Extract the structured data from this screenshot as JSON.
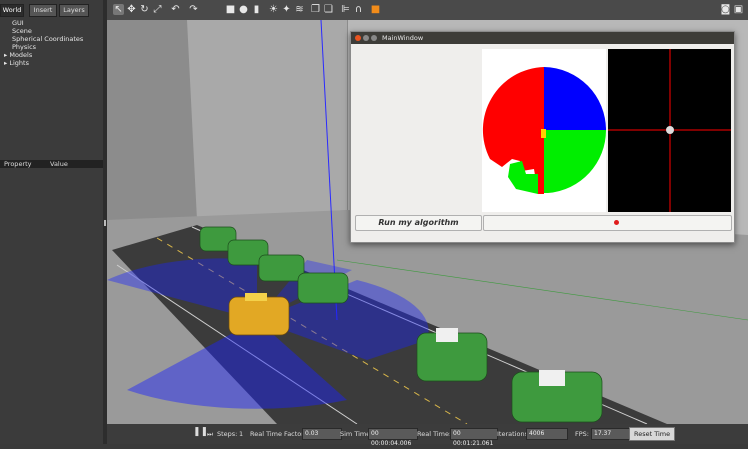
{
  "left_panel": {
    "tabs": [
      "World",
      "Insert",
      "Layers"
    ],
    "tree": [
      "GUI",
      "Scene",
      "Spherical Coordinates",
      "Physics",
      "Models",
      "Lights"
    ],
    "property_header": {
      "property": "Property",
      "value": "Value"
    }
  },
  "toolbar": {
    "icons": [
      "select-arrow-icon",
      "translate-icon",
      "rotate-icon",
      "scale-icon",
      "undo-icon",
      "redo-icon",
      "box-icon",
      "sphere-icon",
      "cylinder-icon",
      "sun-icon",
      "spot-light-icon",
      "directional-light-icon",
      "copy-icon",
      "paste-icon",
      "align-icon",
      "snap-icon",
      "record-icon",
      "screenshot-icon"
    ]
  },
  "main_window": {
    "title": "MainWindow",
    "run_button": "Run my algorithm",
    "colors": {
      "red": "#ff0000",
      "blue": "#0000ff",
      "green": "#00ee00",
      "crosshair": "#ff0000"
    }
  },
  "bottom_bar": {
    "steps_label": "Steps:",
    "steps_value": "1",
    "real_time_factor_label": "Real Time Factor:",
    "real_time_factor_value": "0.03",
    "sim_time_label": "Sim Time:",
    "sim_time_value": "00 00:00:04.006",
    "real_time_label": "Real Time:",
    "real_time_value": "00 00:01:21.061",
    "iterations_label": "Iterations:",
    "iterations_value": "4006",
    "fps_label": "FPS:",
    "fps_value": "17.37",
    "reset_time": "Reset Time"
  }
}
